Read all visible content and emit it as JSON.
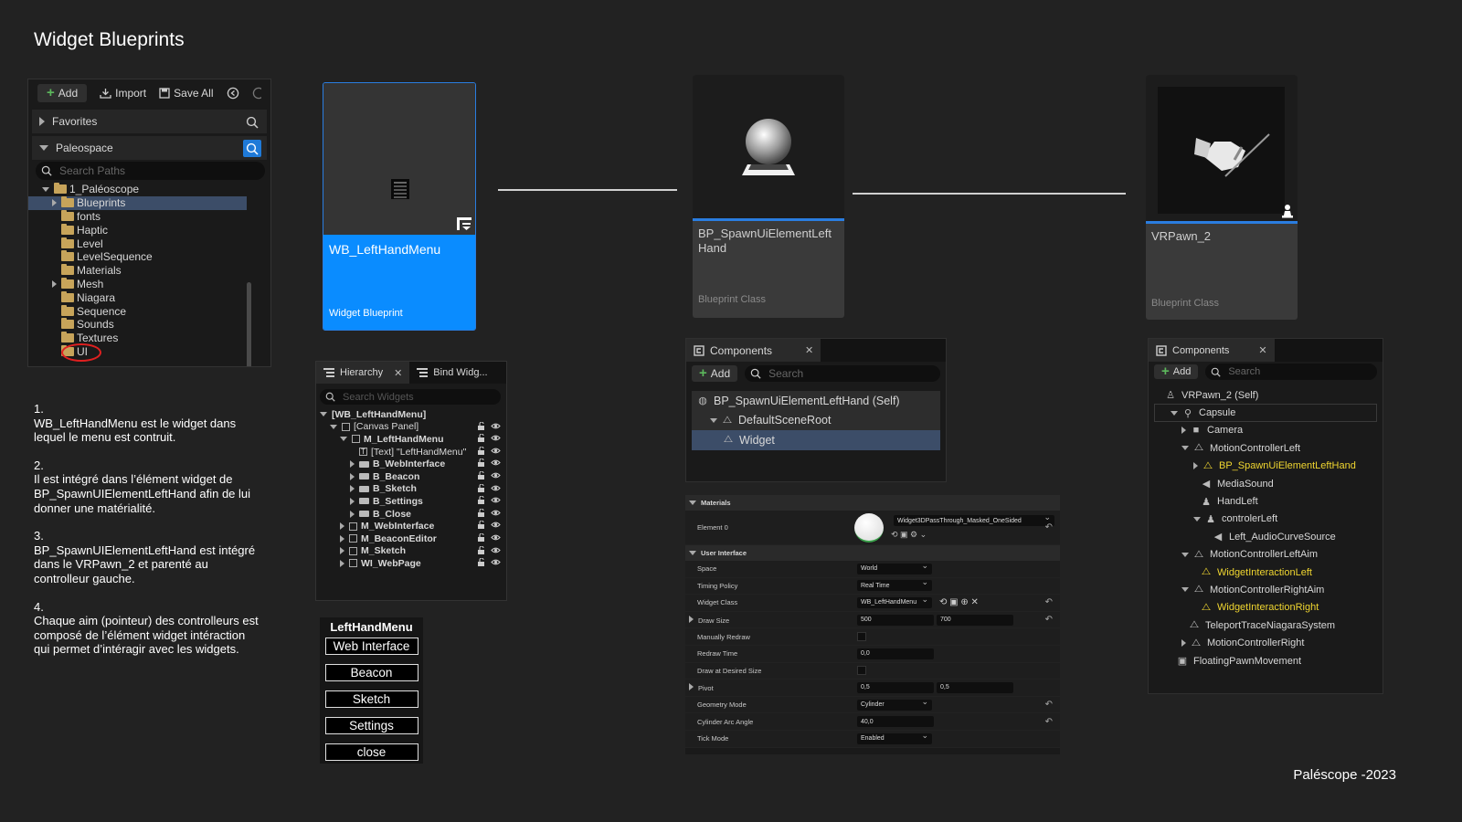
{
  "title": "Widget Blueprints",
  "footer": "Paléscope -2023",
  "content_browser": {
    "toolbar": {
      "add": "Add",
      "import": "Import",
      "save_all": "Save All"
    },
    "favorites": "Favorites",
    "project": "Paleospace",
    "search_placeholder": "Search Paths",
    "tree": [
      {
        "label": "1_Paléoscope",
        "indent": 1,
        "expander": "down",
        "selected": false
      },
      {
        "label": "Blueprints",
        "indent": 2,
        "expander": "right",
        "selected": true
      },
      {
        "label": "fonts",
        "indent": 2,
        "expander": "none",
        "selected": false
      },
      {
        "label": "Haptic",
        "indent": 2,
        "expander": "none",
        "selected": false
      },
      {
        "label": "Level",
        "indent": 2,
        "expander": "none",
        "selected": false
      },
      {
        "label": "LevelSequence",
        "indent": 2,
        "expander": "none",
        "selected": false
      },
      {
        "label": "Materials",
        "indent": 2,
        "expander": "none",
        "selected": false
      },
      {
        "label": "Mesh",
        "indent": 2,
        "expander": "right",
        "selected": false
      },
      {
        "label": "Niagara",
        "indent": 2,
        "expander": "none",
        "selected": false
      },
      {
        "label": "Sequence",
        "indent": 2,
        "expander": "none",
        "selected": false
      },
      {
        "label": "Sounds",
        "indent": 2,
        "expander": "none",
        "selected": false
      },
      {
        "label": "Textures",
        "indent": 2,
        "expander": "none",
        "selected": false
      },
      {
        "label": "UI",
        "indent": 2,
        "expander": "none",
        "selected": false
      }
    ]
  },
  "description": [
    {
      "num": "1.",
      "text": "WB_LeftHandMenu est le widget dans lequel le menu est contruit."
    },
    {
      "num": "2.",
      "text": "Il est intégré dans l’élément widget de BP_SpawnUIElementLeftHand afin de lui donner une matérialité."
    },
    {
      "num": "3.",
      "text": "BP_SpawnUIElementLeftHand est intégré dans le VRPawn_2 et parenté au controlleur gauche."
    },
    {
      "num": "4.",
      "text": "Chaque aim (pointeur) des controlleurs est composé de l’élément widget intéraction qui permet d’intéragir avec les widgets."
    }
  ],
  "cards": {
    "widget": {
      "name": "WB_LeftHandMenu",
      "type": "Widget Blueprint"
    },
    "spawn": {
      "name": "BP_SpawnUiElementLeft Hand",
      "type": "Blueprint Class"
    },
    "pawn": {
      "name": "VRPawn_2",
      "type": "Blueprint Class"
    }
  },
  "hierarchy": {
    "tab1": "Hierarchy",
    "tab2": "Bind Widg...",
    "search_placeholder": "Search Widgets",
    "rows": [
      {
        "label": "[WB_LeftHandMenu]",
        "indent": 0,
        "expander": "down",
        "icon": "none",
        "bold": true,
        "icons": false
      },
      {
        "label": "[Canvas Panel]",
        "indent": 1,
        "expander": "down",
        "icon": "box",
        "bold": false,
        "icons": true
      },
      {
        "label": "M_LeftHandMenu",
        "indent": 2,
        "expander": "down",
        "icon": "box",
        "bold": true,
        "icons": true
      },
      {
        "label": "[Text] \"LeftHandMenu\"",
        "indent": 3,
        "expander": "none",
        "icon": "text",
        "bold": false,
        "icons": true
      },
      {
        "label": "B_WebInterface",
        "indent": 3,
        "expander": "right",
        "icon": "button",
        "bold": true,
        "icons": true
      },
      {
        "label": "B_Beacon",
        "indent": 3,
        "expander": "right",
        "icon": "button",
        "bold": true,
        "icons": true
      },
      {
        "label": "B_Sketch",
        "indent": 3,
        "expander": "right",
        "icon": "button",
        "bold": true,
        "icons": true
      },
      {
        "label": "B_Settings",
        "indent": 3,
        "expander": "right",
        "icon": "button",
        "bold": true,
        "icons": true
      },
      {
        "label": "B_Close",
        "indent": 3,
        "expander": "right",
        "icon": "button",
        "bold": true,
        "icons": true
      },
      {
        "label": "M_WebInterface",
        "indent": 2,
        "expander": "right",
        "icon": "box",
        "bold": true,
        "icons": true
      },
      {
        "label": "M_BeaconEditor",
        "indent": 2,
        "expander": "right",
        "icon": "box",
        "bold": true,
        "icons": true
      },
      {
        "label": "M_Sketch",
        "indent": 2,
        "expander": "right",
        "icon": "box",
        "bold": true,
        "icons": true
      },
      {
        "label": "WI_WebPage",
        "indent": 2,
        "expander": "right",
        "icon": "box",
        "bold": true,
        "icons": true
      }
    ]
  },
  "preview": {
    "title": "LeftHandMenu",
    "buttons": [
      "Web Interface",
      "Beacon",
      "Sketch",
      "Settings",
      "close"
    ]
  },
  "components1": {
    "tab": "Components",
    "add": "Add",
    "search_placeholder": "Search",
    "rows": [
      {
        "label": "BP_SpawnUiElementLeftHand (Self)",
        "indent": 0,
        "expander": "none",
        "selected": false
      },
      {
        "label": "DefaultSceneRoot",
        "indent": 1,
        "expander": "down",
        "selected": false
      },
      {
        "label": "Widget",
        "indent": 2,
        "expander": "none",
        "selected": true
      }
    ]
  },
  "components2": {
    "tab": "Components",
    "add": "Add",
    "search_placeholder": "Search",
    "rows": [
      {
        "label": "VRPawn_2 (Self)",
        "indent": 0,
        "expander": "none",
        "color": "normal"
      },
      {
        "label": "Capsule",
        "indent": 1,
        "expander": "down",
        "color": "normal"
      },
      {
        "label": "Camera",
        "indent": 2,
        "expander": "right",
        "color": "normal"
      },
      {
        "label": "MotionControllerLeft",
        "indent": 2,
        "expander": "down",
        "color": "normal"
      },
      {
        "label": "BP_SpawnUiElementLeftHand",
        "indent": 3,
        "expander": "right",
        "color": "yellow"
      },
      {
        "label": "MediaSound",
        "indent": 3,
        "expander": "none",
        "color": "normal"
      },
      {
        "label": "HandLeft",
        "indent": 3,
        "expander": "none",
        "color": "normal"
      },
      {
        "label": "controlerLeft",
        "indent": 3,
        "expander": "down",
        "color": "normal"
      },
      {
        "label": "Left_AudioCurveSource",
        "indent": 4,
        "expander": "none",
        "color": "normal"
      },
      {
        "label": "MotionControllerLeftAim",
        "indent": 2,
        "expander": "down",
        "color": "normal"
      },
      {
        "label": "WidgetInteractionLeft",
        "indent": 3,
        "expander": "none",
        "color": "yellow"
      },
      {
        "label": "MotionControllerRightAim",
        "indent": 2,
        "expander": "down",
        "color": "normal"
      },
      {
        "label": "WidgetInteractionRight",
        "indent": 3,
        "expander": "none",
        "color": "yellow"
      },
      {
        "label": "TeleportTraceNiagaraSystem",
        "indent": 2,
        "expander": "none",
        "color": "normal"
      },
      {
        "label": "MotionControllerRight",
        "indent": 2,
        "expander": "right",
        "color": "normal"
      },
      {
        "label": "FloatingPawnMovement",
        "indent": 1,
        "expander": "none",
        "color": "normal"
      }
    ]
  },
  "details": {
    "materials_cat": "Materials",
    "element0_label": "Element 0",
    "element0_value": "Widget3DPassThrough_Masked_OneSided",
    "ui_cat": "User Interface",
    "rows": [
      {
        "label": "Space",
        "kind": "drop",
        "v1": "World",
        "v2": "",
        "reset": false,
        "expander": false
      },
      {
        "label": "Timing Policy",
        "kind": "drop",
        "v1": "Real Time",
        "v2": "",
        "reset": false,
        "expander": false
      },
      {
        "label": "Widget Class",
        "kind": "class",
        "v1": "WB_LeftHandMenu",
        "v2": "",
        "reset": true,
        "expander": false
      },
      {
        "label": "Draw Size",
        "kind": "pair",
        "v1": "500",
        "v2": "700",
        "reset": true,
        "expander": true
      },
      {
        "label": "Manually Redraw",
        "kind": "check",
        "v1": "",
        "v2": "",
        "reset": false,
        "expander": false
      },
      {
        "label": "Redraw Time",
        "kind": "field",
        "v1": "0,0",
        "v2": "",
        "reset": false,
        "expander": false
      },
      {
        "label": "Draw at Desired Size",
        "kind": "check",
        "v1": "",
        "v2": "",
        "reset": false,
        "expander": false
      },
      {
        "label": "Pivot",
        "kind": "pair",
        "v1": "0,5",
        "v2": "0,5",
        "reset": false,
        "expander": true
      },
      {
        "label": "Geometry Mode",
        "kind": "drop",
        "v1": "Cylinder",
        "v2": "",
        "reset": true,
        "expander": false
      },
      {
        "label": "Cylinder Arc Angle",
        "kind": "field",
        "v1": "40,0",
        "v2": "",
        "reset": true,
        "expander": false
      },
      {
        "label": "Tick Mode",
        "kind": "drop",
        "v1": "Enabled",
        "v2": "",
        "reset": false,
        "expander": false
      }
    ]
  }
}
